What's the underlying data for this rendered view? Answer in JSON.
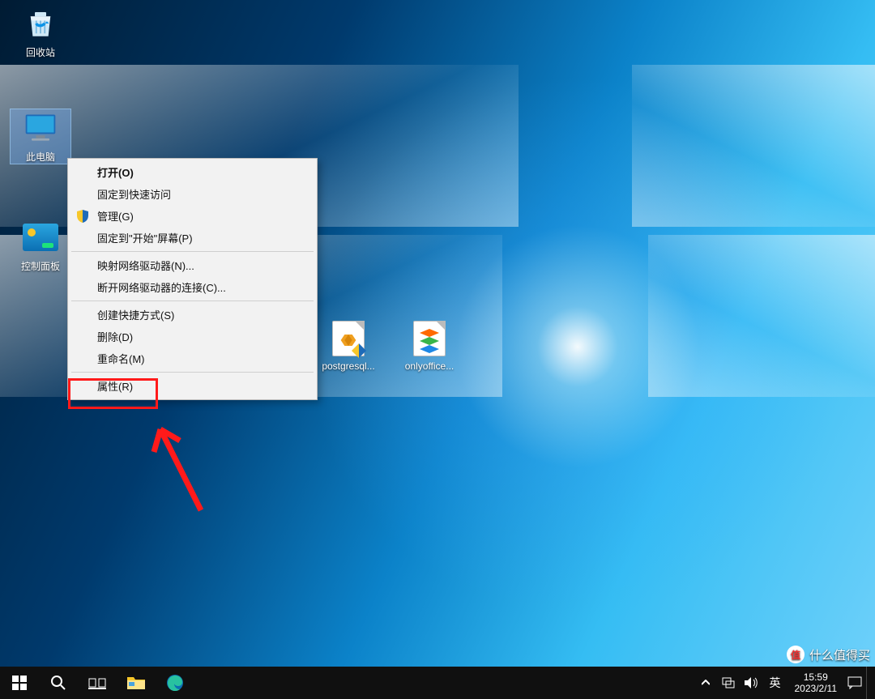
{
  "desktop": {
    "icons": {
      "recycle_bin": "回收站",
      "this_pc": "此电脑",
      "control_panel": "控制面板",
      "postgresql": "postgresql...",
      "onlyoffice": "onlyoffice..."
    }
  },
  "context_menu": {
    "open": "打开(O)",
    "pin_quick_access": "固定到快速访问",
    "manage": "管理(G)",
    "pin_start": "固定到\"开始\"屏幕(P)",
    "map_drive": "映射网络驱动器(N)...",
    "disconnect_drive": "断开网络驱动器的连接(C)...",
    "create_shortcut": "创建快捷方式(S)",
    "delete": "删除(D)",
    "rename": "重命名(M)",
    "properties": "属性(R)"
  },
  "taskbar": {
    "ime_lang": "英",
    "clock_time": "15:59",
    "clock_date": "2023/2/11"
  },
  "watermark": {
    "brand": "值",
    "text": "什么值得买"
  }
}
